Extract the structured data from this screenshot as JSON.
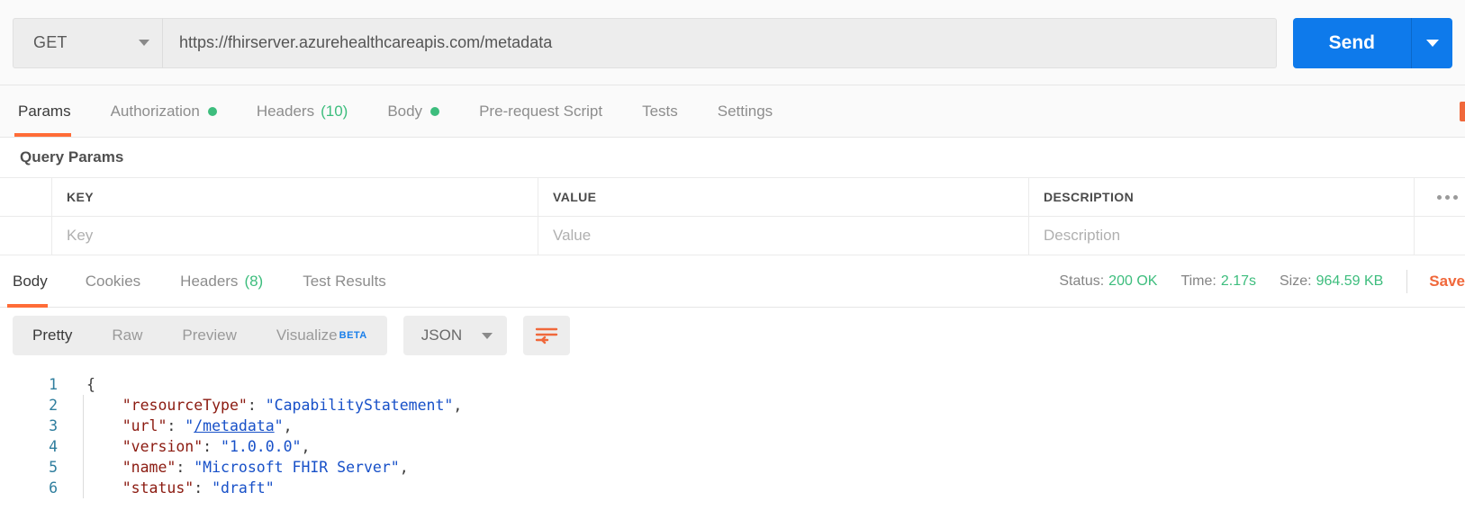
{
  "request": {
    "method": "GET",
    "method_caret_icon": "chevron-down-icon",
    "url": "https://fhirserver.azurehealthcareapis.com/metadata",
    "send_label": "Send",
    "send_caret_icon": "chevron-down-icon",
    "tabs": [
      {
        "label": "Params",
        "active": true,
        "dot": false,
        "count": ""
      },
      {
        "label": "Authorization",
        "active": false,
        "dot": true,
        "count": ""
      },
      {
        "label": "Headers",
        "active": false,
        "dot": false,
        "count": "(10)"
      },
      {
        "label": "Body",
        "active": false,
        "dot": true,
        "count": ""
      },
      {
        "label": "Pre-request Script",
        "active": false,
        "dot": false,
        "count": ""
      },
      {
        "label": "Tests",
        "active": false,
        "dot": false,
        "count": ""
      },
      {
        "label": "Settings",
        "active": false,
        "dot": false,
        "count": ""
      }
    ]
  },
  "query_params": {
    "title": "Query Params",
    "columns": {
      "key": "KEY",
      "value": "VALUE",
      "description": "DESCRIPTION"
    },
    "placeholders": {
      "key": "Key",
      "value": "Value",
      "description": "Description"
    },
    "bulk_edit_icon": "ellipsis-icon"
  },
  "response": {
    "tabs": [
      {
        "label": "Body",
        "active": true,
        "count": ""
      },
      {
        "label": "Cookies",
        "active": false,
        "count": ""
      },
      {
        "label": "Headers",
        "active": false,
        "count": "(8)"
      },
      {
        "label": "Test Results",
        "active": false,
        "count": ""
      }
    ],
    "status_label": "Status:",
    "status_value": "200 OK",
    "time_label": "Time:",
    "time_value": "2.17s",
    "size_label": "Size:",
    "size_value": "964.59 KB",
    "save_label": "Save"
  },
  "viewer": {
    "modes": [
      {
        "label": "Pretty",
        "active": true,
        "badge": ""
      },
      {
        "label": "Raw",
        "active": false,
        "badge": ""
      },
      {
        "label": "Preview",
        "active": false,
        "badge": ""
      },
      {
        "label": "Visualize",
        "active": false,
        "badge": "BETA"
      }
    ],
    "format": "JSON",
    "format_caret_icon": "chevron-down-icon",
    "wrap_icon": "text-wrap-icon"
  },
  "code": {
    "lines": [
      {
        "n": "1",
        "tokens": [
          {
            "t": "p",
            "v": "{"
          }
        ]
      },
      {
        "n": "2",
        "tokens": [
          {
            "t": "p",
            "v": "    "
          },
          {
            "t": "k",
            "v": "\"resourceType\""
          },
          {
            "t": "p",
            "v": ": "
          },
          {
            "t": "s",
            "v": "\"CapabilityStatement\""
          },
          {
            "t": "p",
            "v": ","
          }
        ]
      },
      {
        "n": "3",
        "tokens": [
          {
            "t": "p",
            "v": "    "
          },
          {
            "t": "k",
            "v": "\"url\""
          },
          {
            "t": "p",
            "v": ": "
          },
          {
            "t": "s",
            "v": "\""
          },
          {
            "t": "lnk",
            "v": "/metadata"
          },
          {
            "t": "s",
            "v": "\""
          },
          {
            "t": "p",
            "v": ","
          }
        ]
      },
      {
        "n": "4",
        "tokens": [
          {
            "t": "p",
            "v": "    "
          },
          {
            "t": "k",
            "v": "\"version\""
          },
          {
            "t": "p",
            "v": ": "
          },
          {
            "t": "s",
            "v": "\"1.0.0.0\""
          },
          {
            "t": "p",
            "v": ","
          }
        ]
      },
      {
        "n": "5",
        "tokens": [
          {
            "t": "p",
            "v": "    "
          },
          {
            "t": "k",
            "v": "\"name\""
          },
          {
            "t": "p",
            "v": ": "
          },
          {
            "t": "s",
            "v": "\"Microsoft FHIR Server\""
          },
          {
            "t": "p",
            "v": ","
          }
        ]
      },
      {
        "n": "6",
        "tokens": [
          {
            "t": "p",
            "v": "    "
          },
          {
            "t": "k",
            "v": "\"status\""
          },
          {
            "t": "p",
            "v": ": "
          },
          {
            "t": "s",
            "v": "\"draft\""
          }
        ]
      }
    ]
  },
  "colors": {
    "accent_orange": "#ff6c37",
    "send_blue": "#0e7aeb",
    "success_green": "#3dbd7d",
    "beta_blue": "#1a7fea",
    "json_key": "#8b1a10",
    "json_string": "#1750c8",
    "line_number": "#2f7e9e"
  }
}
